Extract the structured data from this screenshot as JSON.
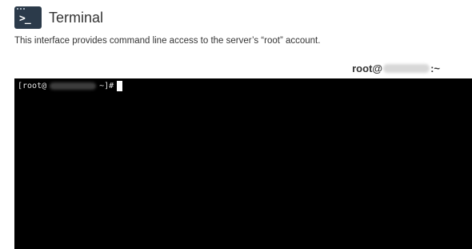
{
  "header": {
    "icon": "terminal-icon",
    "icon_glyph": ">_",
    "title": "Terminal"
  },
  "description": "This interface provides command line access to the server’s “root” account.",
  "session": {
    "user": "root@",
    "suffix": ":~"
  },
  "terminal": {
    "prompt_start": "[root@",
    "prompt_end": "~]#",
    "background": "#000000",
    "text_color": "#e5e5e5"
  }
}
